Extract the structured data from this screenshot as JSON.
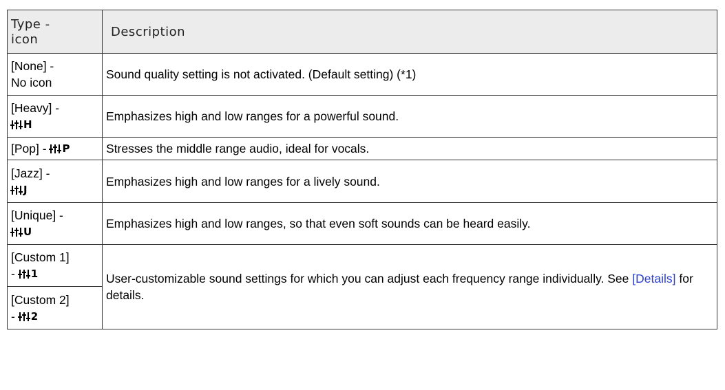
{
  "table": {
    "header": {
      "type_icon": [
        "Type -",
        "icon"
      ],
      "description": "Description"
    },
    "rows": [
      {
        "type": "[None] -",
        "type_suffix": "No icon",
        "icon": null,
        "description": "Sound quality setting is not activated. (Default setting) (*1)"
      },
      {
        "type": "[Heavy] -",
        "icon": {
          "name": "eq-heavy-icon",
          "letter": "H"
        },
        "description": "Emphasizes high and low ranges for a powerful sound."
      },
      {
        "type": "[Pop] -",
        "icon": {
          "name": "eq-pop-icon",
          "letter": "P"
        },
        "description": "Stresses the middle range audio, ideal for vocals."
      },
      {
        "type": "[Jazz] -",
        "icon": {
          "name": "eq-jazz-icon",
          "letter": "J"
        },
        "description": "Emphasizes high and low ranges for a lively sound."
      },
      {
        "type": "[Unique] -",
        "icon": {
          "name": "eq-unique-icon",
          "letter": "U"
        },
        "description": "Emphasizes high and low ranges, so that even soft sounds can be heard easily."
      },
      {
        "type": "[Custom 1]",
        "type_prefix": "-",
        "icon": {
          "name": "eq-custom1-icon",
          "letter": "1"
        }
      },
      {
        "type": "[Custom 2]",
        "type_prefix": "-",
        "icon": {
          "name": "eq-custom2-icon",
          "letter": "2"
        }
      }
    ],
    "custom_description": {
      "before_link": "User-customizable sound settings for which you can adjust each frequency range individually. See ",
      "link": "[Details]",
      "after_link": " for details."
    }
  },
  "colors": {
    "header_bg": "#ececec",
    "border": "#333333",
    "link": "#2b3fd6"
  }
}
